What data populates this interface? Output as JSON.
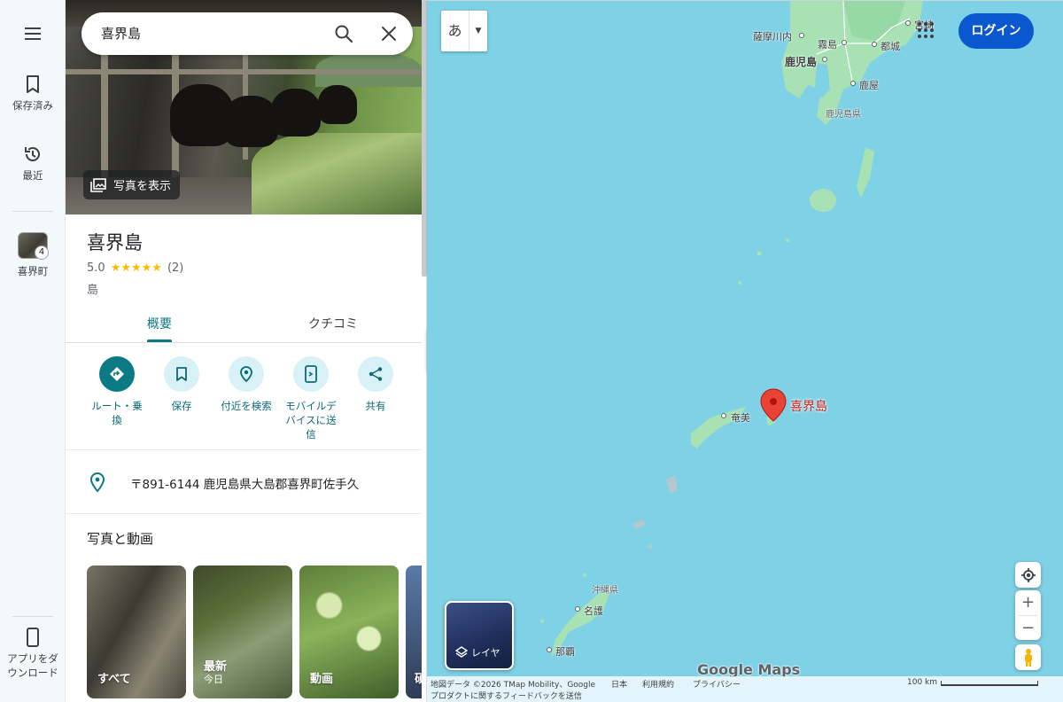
{
  "rail": {
    "saved_label": "保存済み",
    "recent_label": "最近",
    "history_item_label": "喜界町",
    "history_item_count": "4",
    "download_app_label_1": "アプリをダ",
    "download_app_label_2": "ウンロード"
  },
  "search": {
    "query": "喜界島"
  },
  "hero": {
    "show_photos_label": "写真を表示"
  },
  "place": {
    "title": "喜界島",
    "rating": "5.0",
    "stars": "★★★★★",
    "review_count": "(2)",
    "category": "島"
  },
  "tabs": [
    {
      "label": "概要",
      "active": true
    },
    {
      "label": "クチコミ",
      "active": false
    }
  ],
  "actions": [
    {
      "label_1": "ルート・乗",
      "label_2": "換",
      "label_3": "",
      "icon": "directions-icon"
    },
    {
      "label_1": "保存",
      "label_2": "",
      "label_3": "",
      "icon": "bookmark-icon"
    },
    {
      "label_1": "付近を検索",
      "label_2": "",
      "label_3": "",
      "icon": "nearby-icon"
    },
    {
      "label_1": "モバイルデ",
      "label_2": "バイスに送",
      "label_3": "信",
      "icon": "send-to-phone-icon"
    },
    {
      "label_1": "共有",
      "label_2": "",
      "label_3": "",
      "icon": "share-icon"
    }
  ],
  "address": "〒891-6144 鹿児島県大島郡喜界町佐手久",
  "photos_section": {
    "title": "写真と動画",
    "items": [
      {
        "caption": "すべて",
        "sub": ""
      },
      {
        "caption": "最新",
        "sub": "今日"
      },
      {
        "caption": "動画",
        "sub": ""
      },
      {
        "caption": "碩",
        "sub": ""
      }
    ]
  },
  "map": {
    "ime_label": "あ",
    "login_label": "ログイン",
    "marker_label": "喜界島",
    "layer_label": "レイヤ",
    "logo_text": "Google Maps",
    "place_labels": {
      "satsumasendai": "薩摩川内",
      "kirishima": "霧島",
      "miyakonojo": "都城",
      "miyazaki": "宮崎",
      "kagoshima": "鹿児島",
      "kanoya": "鹿屋",
      "kagoshima_pref": "鹿児島県",
      "amami": "奄美",
      "okinawa_pref": "沖縄県",
      "nago": "名護",
      "naha": "那覇"
    },
    "footer": {
      "map_data": "地図データ ©2026 TMap Mobility、Google",
      "japan": "日本",
      "terms": "利用規約",
      "privacy": "プライバシー",
      "feedback": "プロダクトに関するフィードバックを送信",
      "scale": "100 km"
    }
  },
  "colors": {
    "accent": "#0b7a84",
    "action_bg": "#d8f1f6",
    "login": "#0b57d0",
    "sea": "#7fd1e6",
    "land": "#a8e2b4",
    "marker": "#ea4335"
  }
}
